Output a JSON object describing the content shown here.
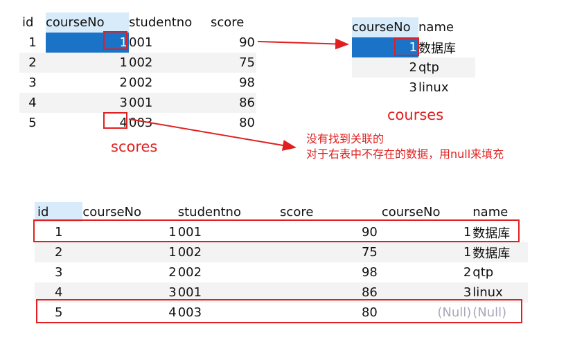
{
  "scores_table": {
    "columns": [
      "id",
      "courseNo",
      "studentno",
      "score"
    ],
    "rows": [
      [
        "1",
        "1",
        "001",
        "90"
      ],
      [
        "2",
        "1",
        "002",
        "75"
      ],
      [
        "3",
        "2",
        "002",
        "98"
      ],
      [
        "4",
        "3",
        "001",
        "86"
      ],
      [
        "5",
        "4",
        "003",
        "80"
      ]
    ],
    "caption": "scores"
  },
  "courses_table": {
    "columns": [
      "courseNo",
      "name"
    ],
    "rows": [
      [
        "1",
        "数据库"
      ],
      [
        "2",
        "qtp"
      ],
      [
        "3",
        "linux"
      ]
    ],
    "caption": "courses"
  },
  "note": {
    "line1": "没有找到关联的",
    "line2": "对于右表中不存在的数据，用null来填充"
  },
  "result_table": {
    "columns": [
      "id",
      "courseNo",
      "studentno",
      "score",
      "courseNo",
      "name"
    ],
    "rows": [
      [
        "1",
        "1",
        "001",
        "90",
        "1",
        "数据库"
      ],
      [
        "2",
        "1",
        "002",
        "75",
        "1",
        "数据库"
      ],
      [
        "3",
        "2",
        "002",
        "98",
        "2",
        "qtp"
      ],
      [
        "4",
        "3",
        "001",
        "86",
        "3",
        "linux"
      ],
      [
        "5",
        "4",
        "003",
        "80",
        "(Null)",
        "(Null)"
      ]
    ]
  },
  "colors": {
    "selection": "#1a73c6",
    "header_selected": "#d7ebfa",
    "annotation": "#e02020",
    "null_text": "#a8a8b8"
  }
}
